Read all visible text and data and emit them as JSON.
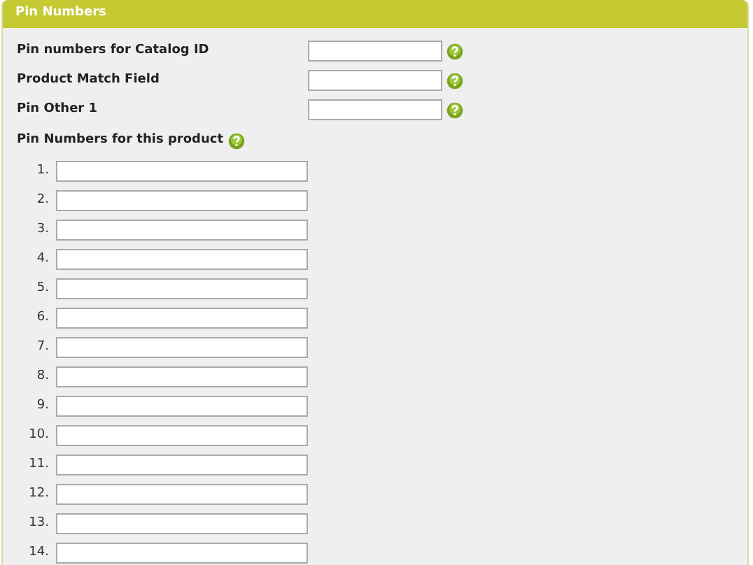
{
  "panel": {
    "title": "Pin Numbers"
  },
  "fields": [
    {
      "label": "Pin numbers for Catalog ID"
    },
    {
      "label": "Product Match Field"
    },
    {
      "label": "Pin Other 1"
    }
  ],
  "pin_list": {
    "label": "Pin Numbers for this product",
    "items": [
      {
        "number": "1."
      },
      {
        "number": "2."
      },
      {
        "number": "3."
      },
      {
        "number": "4."
      },
      {
        "number": "5."
      },
      {
        "number": "6."
      },
      {
        "number": "7."
      },
      {
        "number": "8."
      },
      {
        "number": "9."
      },
      {
        "number": "10."
      },
      {
        "number": "11."
      },
      {
        "number": "12."
      },
      {
        "number": "13."
      },
      {
        "number": "14."
      }
    ]
  }
}
